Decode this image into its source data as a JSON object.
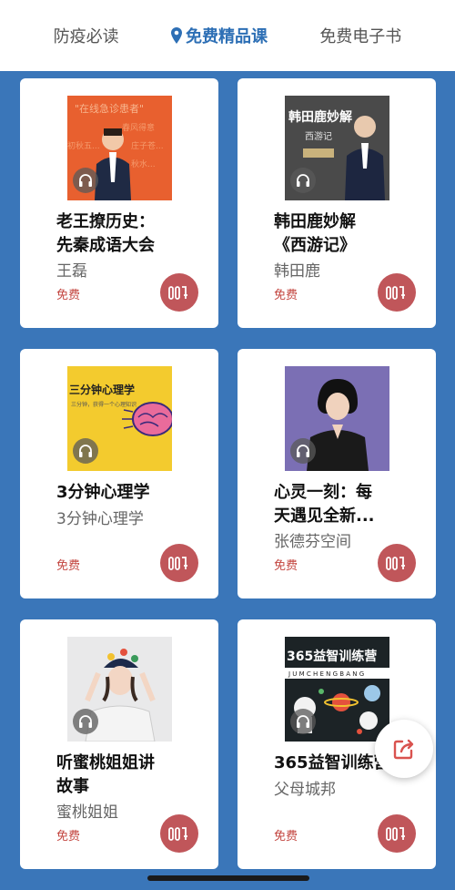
{
  "tabs": [
    {
      "label": "防疫必读",
      "active": false
    },
    {
      "label": "免费精品课",
      "active": true
    },
    {
      "label": "免费电子书",
      "active": false
    }
  ],
  "courses": [
    {
      "title": "老王撩历史：\n先秦成语大会",
      "author": "王磊",
      "price": "免费",
      "cover_text": "\"在线急诊患者\"",
      "cover_color": "#e8602f"
    },
    {
      "title": "韩田鹿妙解\n《西游记》",
      "author": "韩田鹿",
      "price": "免费",
      "cover_text": "韩田鹿妙解",
      "cover_sub": "西游记",
      "cover_color": "#4a4a4a"
    },
    {
      "title": "3分钟心理学",
      "author": "3分钟心理学",
      "price": "免费",
      "cover_text": "三分钟心理学",
      "cover_sub": "三分钟，获得一个心理知识",
      "cover_color": "#f3cb2e"
    },
    {
      "title": "心灵一刻：每\n天遇见全新...",
      "author": "张德芬空间",
      "price": "免费",
      "cover_color": "#7b6fb4"
    },
    {
      "title": "听蜜桃姐姐讲\n故事",
      "author": "蜜桃姐姐",
      "price": "免费",
      "cover_color": "#e9e9ea"
    },
    {
      "title": "365益智训练营",
      "author": "父母城邦",
      "price": "免费",
      "cover_text": "365益智训练营",
      "cover_sub": "J U M C H E N G B A N G",
      "cover_color": "#1c2326"
    }
  ],
  "icons": {
    "location": "location-pin-icon",
    "play": "headphone-icon",
    "listen": "audio-bars-icon",
    "share": "share-icon"
  },
  "colors": {
    "accent": "#2d6fb5",
    "price": "#c3453f",
    "listen_btn": "#c0565a",
    "background": "#3a76b9"
  }
}
